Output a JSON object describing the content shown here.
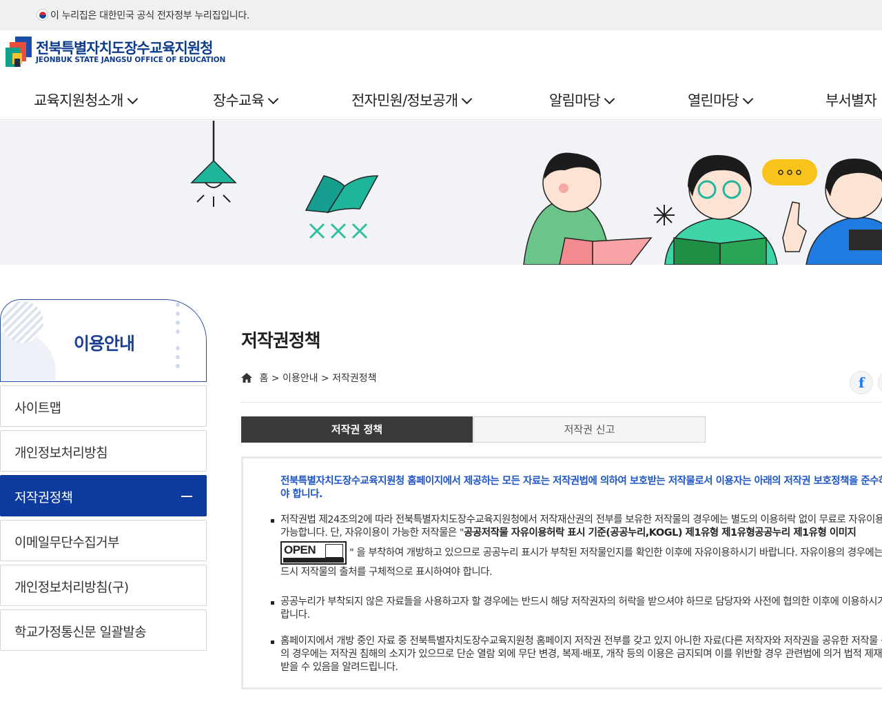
{
  "gov_banner": {
    "text": "이 누리집은 대한민국 공식 전자정부 누리집입니다."
  },
  "logo": {
    "kr": "전북특별자치도장수교육지원청",
    "en": "JEONBUK STATE JANGSU OFFICE OF EDUCATION"
  },
  "gnb": [
    {
      "label": "교육지원청소개"
    },
    {
      "label": "장수교육"
    },
    {
      "label": "전자민원/정보공개"
    },
    {
      "label": "알림마당"
    },
    {
      "label": "열린마당"
    },
    {
      "label": "부서별자"
    }
  ],
  "sidebar": {
    "title": "이용안내",
    "items": [
      {
        "label": "사이트맵"
      },
      {
        "label": "개인정보처리방침"
      },
      {
        "label": "저작권정책",
        "active": true
      },
      {
        "label": "이메일무단수집거부"
      },
      {
        "label": "개인정보처리방침(구)"
      },
      {
        "label": "학교가정통신문 일괄발송"
      }
    ]
  },
  "page": {
    "title": "저작권정책"
  },
  "breadcrumb": {
    "home": "홈",
    "sep1": ">",
    "level1": "이용안내",
    "sep2": ">",
    "level2": "저작권정책"
  },
  "tabs": [
    {
      "label": "저작권 정책"
    },
    {
      "label": "저작권 신고"
    }
  ],
  "content": {
    "lead": "전북특별자치도장수교육지원청 홈페이지에서 제공하는 모든 자료는 저작권법에 의하여 보호받는 저작물로서 이용자는 아래의 저작권 보호정책을 준수하셔야 합니다.",
    "p1_a": "저작권법 제24조의2에 따라 전북특별자치도장수교육지원청에서 저작재산권의 전부를 보유한 저작물의 경우에는 별도의 이용허락 없이 무료로 자유이용이 가능합니다. 단, 자유이용이 가능한 저작물은 \"",
    "p1_b": "공공저작물 자유이용허락 표시 기준(공공누리,KOGL) 제1유형 제1유형공공누리 제1유형 이미지",
    "p1_c": "\" 을 부착하여 개방하고 있으므로 공공누리 표시가 부착된 저작물인지를 확인한 이후에 자유이용하시기 바랍니다. 자유이용의 경우에는 반드시 저작물의 출처를 구체적으로 표시하여야 합니다.",
    "kogl_text": "OPEN",
    "p2": "공공누리가 부착되지 않은 자료들을 사용하고자 할 경우에는 반드시 해당 저작권자의 허락을 받으셔야 하므로 담당자와 사전에 협의한 이후에 이용하시기 바랍니다.",
    "p3": "홈페이지에서 개방 중인 자료 중 전북특별자치도장수교육지원청 홈페이지 저작권 전부를 갖고 있지 아니한 자료(다른 저작자와 저작권을 공유한 저작물 등)의 경우에는 저작권 침해의 소지가 있으므로 단순 열람 외에 무단 변경, 복제·배포, 개작 등의 이용은 금지되며 이를 위반할 경우 관련법에 의거 법적 제재를 받을 수 있음을 알려드립니다."
  },
  "colors": {
    "brand_blue": "#0d3b9e",
    "lead_blue": "#1f55c4",
    "teal": "#159e90"
  }
}
